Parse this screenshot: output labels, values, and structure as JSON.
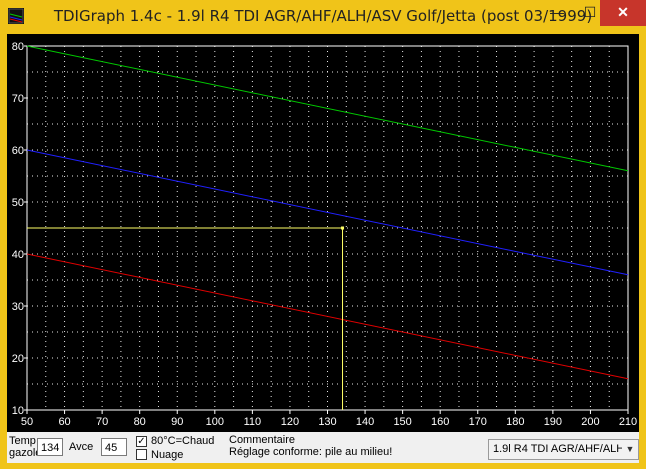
{
  "window": {
    "title": "TDIGraph 1.4c - 1.9l R4 TDI AGR/AHF/ALH/ASV Golf/Jetta (post 03/1999)",
    "min_glyph": "—",
    "max_glyph": "☐",
    "close_glyph": "✕"
  },
  "colors": {
    "titlebar": "#f0c419",
    "plot_bg": "#000000",
    "axis": "#ffffff",
    "grid": "#ffffff",
    "green": "#00c800",
    "blue": "#2020ff",
    "red": "#e00000",
    "marker": "#ffff66"
  },
  "chart_data": {
    "type": "line",
    "x_ticks": [
      50,
      60,
      70,
      80,
      90,
      100,
      110,
      120,
      130,
      140,
      150,
      160,
      170,
      180,
      190,
      200,
      210
    ],
    "y_ticks": [
      10,
      20,
      30,
      40,
      50,
      60,
      70,
      80
    ],
    "xlim": [
      50,
      210
    ],
    "ylim": [
      10,
      80
    ],
    "grid": true,
    "series": [
      {
        "color": "#00c800",
        "x": [
          50,
          210
        ],
        "y": [
          80,
          56
        ]
      },
      {
        "color": "#2020ff",
        "x": [
          50,
          210
        ],
        "y": [
          60,
          36
        ]
      },
      {
        "color": "#e00000",
        "x": [
          50,
          210
        ],
        "y": [
          40,
          16
        ]
      }
    ],
    "marker": {
      "x": 134,
      "y": 45
    }
  },
  "controls": {
    "temp_label_line1": "Temp",
    "temp_label_line2": "gazole",
    "temp_value": "134",
    "avce_label": "Avce",
    "avce_value": "45",
    "hot_checkbox_label": "80°C=Chaud",
    "hot_checked": true,
    "cloud_checkbox_label": "Nuage",
    "cloud_checked": false,
    "comment_title": "Commentaire",
    "comment_text": "Réglage conforme: pile au milieu!",
    "engine_select_value": "1.9l R4 TDI AGR/AHF/ALH"
  }
}
